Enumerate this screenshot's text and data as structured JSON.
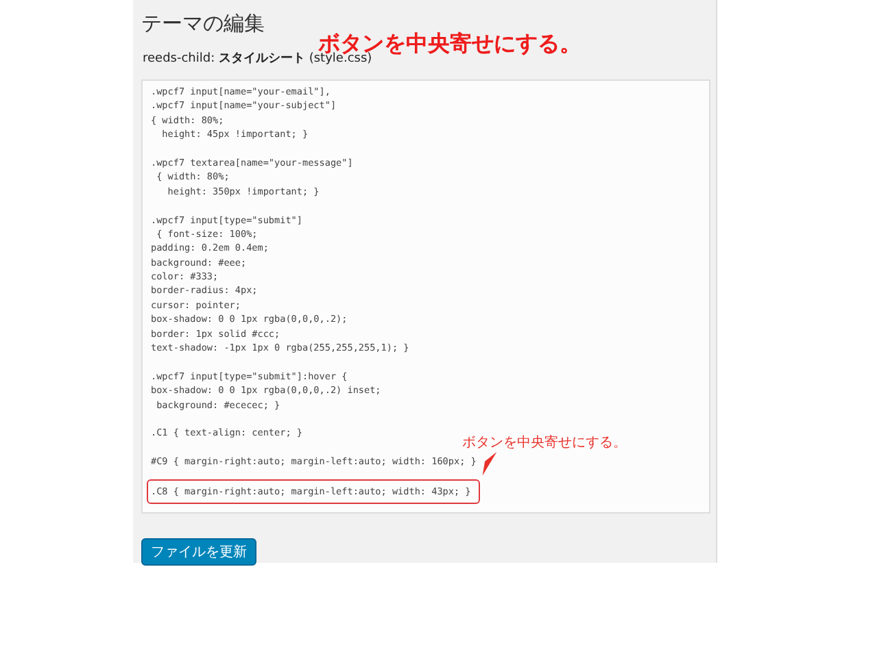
{
  "page_title": "テーマの編集",
  "file_label": "reeds-child: **スタイルシート** (style.css)",
  "code_blocks": [
    {
      "highlighted": false,
      "lines": [
        ".wpcf7 input[name=\"your-email\"],",
        ".wpcf7 input[name=\"your-subject\"]",
        "{ width: 80%;",
        "  height: 45px !important; }"
      ]
    },
    {
      "highlighted": false,
      "lines": [
        ".wpcf7 textarea[name=\"your-message\"]",
        " { width: 80%;",
        "   height: 350px !important; }"
      ]
    },
    {
      "highlighted": false,
      "lines": [
        ".wpcf7 input[type=\"submit\"]",
        " { font-size: 100%;",
        "padding: 0.2em 0.4em;",
        "background: #eee;",
        "color: #333;",
        "border-radius: 4px;",
        "cursor: pointer;",
        "box-shadow: 0 0 1px rgba(0,0,0,.2);",
        "border: 1px solid #ccc;",
        "text-shadow: -1px 1px 0 rgba(255,255,255,1); }"
      ]
    },
    {
      "highlighted": false,
      "lines": [
        ".wpcf7 input[type=\"submit\"]:hover {",
        "box-shadow: 0 0 1px rgba(0,0,0,.2) inset;",
        " background: #ececec; }"
      ]
    },
    {
      "highlighted": false,
      "lines": [
        ".C1 { text-align: center; }"
      ]
    },
    {
      "highlighted": false,
      "lines": [
        "#C9 { margin-right:auto; margin-left:auto; width: 160px; }"
      ]
    },
    {
      "highlighted": true,
      "lines": [
        ".C8 { margin-right:auto; margin-left:auto; width: 43px; }"
      ]
    }
  ],
  "update_button": "ファイルを更新",
  "annotations": {
    "headline": "ボタンを中央寄せにする。",
    "callout": "ボタンを中央寄せにする。"
  }
}
